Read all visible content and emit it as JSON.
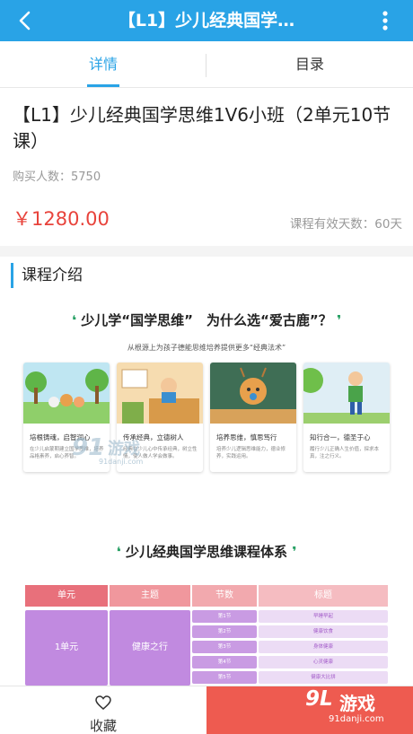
{
  "header": {
    "title": "【L1】少儿经典国学…",
    "back_icon": "chevron-left-icon",
    "more_icon": "more-vertical-icon",
    "bg_color": "#29a3e6"
  },
  "tabs": [
    {
      "label": "详情",
      "active": true
    },
    {
      "label": "目录",
      "active": false
    }
  ],
  "course": {
    "title": "【L1】少儿经典国学思维1V6小班（2单元10节课）",
    "buyers": "购买人数：5750",
    "price": "￥1280.00",
    "valid_days": "课程有效天数：60天"
  },
  "intro": {
    "section_title": "课程介绍",
    "hero_question": "少儿学“国学思维”　为什么选“爱古鹿”？",
    "hero_sub": "从根源上为孩子德能思维培养提供更多“经典法术”",
    "cards": [
      {
        "title": "培根铸魂，启智润心",
        "desc": "在少儿启蒙期建立国学思维，培养品格素养，启心养智。"
      },
      {
        "title": "传承经典，立德树人",
        "desc": "经典在少儿心中传承经典，树立性情，使人做人学会做事。"
      },
      {
        "title": "培养思维，慎思笃行",
        "desc": "培养少儿逻辑思维能力，德业修养，实践运用。"
      },
      {
        "title": "知行合一，德圣于心",
        "desc": "履行少儿正确人生价值，探求本真，注之行义。"
      }
    ],
    "system_title": "少儿经典国学思维课程体系",
    "table": {
      "headers": [
        "单元",
        "主题",
        "节数",
        "标题"
      ],
      "unit": "1单元",
      "theme": "健康之行",
      "rows": [
        {
          "lesson": "第1节",
          "topic": "早睡早起"
        },
        {
          "lesson": "第2节",
          "topic": "健康饮食"
        },
        {
          "lesson": "第3节",
          "topic": "身体健康"
        },
        {
          "lesson": "第4节",
          "topic": "心灵健康"
        },
        {
          "lesson": "第5节",
          "topic": "健康大比拼"
        }
      ]
    }
  },
  "watermark_center": {
    "num": "91",
    "text": "游戏",
    "url": "91danji.com"
  },
  "bottom": {
    "fav_label": "收藏",
    "fav_icon": "heart-outline-icon",
    "buy_color": "#ee5b50"
  },
  "watermark_corner": {
    "logo": "9L",
    "brand": "游戏",
    "url": "91danji.com"
  }
}
